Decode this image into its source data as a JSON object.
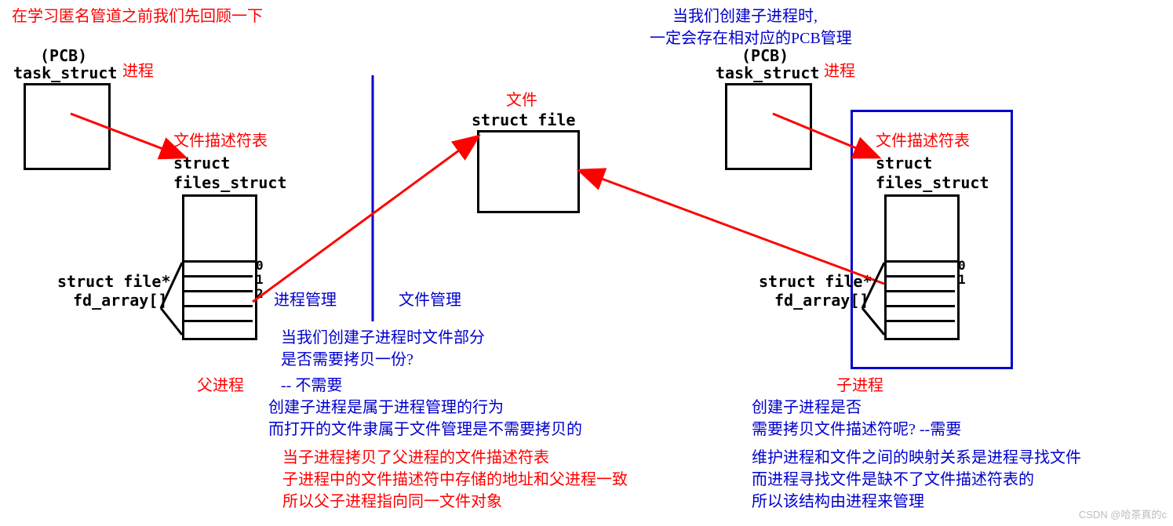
{
  "title_red": "在学习匿名管道之前我们先回顾一下",
  "top_blue_1": "当我们创建子进程时,",
  "top_blue_2": "一定会存在相对应的PCB管理",
  "left": {
    "pcb_paren": "(PCB)",
    "task_struct": "task_struct",
    "process_label": "进程",
    "fd_table_label": "文件描述符表",
    "struct_txt": "struct",
    "files_struct": "files_struct",
    "struct_file_ptr": "struct file*",
    "fd_array": "fd_array[]",
    "n0": "0",
    "n1": "1",
    "n2": "2",
    "left_mgmt": "进程管理",
    "right_mgmt": "文件管理",
    "parent_label": "父进程"
  },
  "center": {
    "file_label": "文件",
    "struct_file": "struct file",
    "q1": "当我们创建子进程时文件部分",
    "q2": "是否需要拷贝一份?",
    "q3": "-- 不需要",
    "q4": "创建子进程是属于进程管理的行为",
    "q5": "而打开的文件隶属于文件管理是不需要拷贝的",
    "r1": "当子进程拷贝了父进程的文件描述符表",
    "r2": "子进程中的文件描述符中存储的地址和父进程一致",
    "r3": "所以父子进程指向同一文件对象"
  },
  "right": {
    "pcb_paren": "(PCB)",
    "task_struct": "task_struct",
    "process_label": "进程",
    "fd_table_label": "文件描述符表",
    "struct_txt": "struct",
    "files_struct": "files_struct",
    "struct_file_ptr": "struct file*",
    "fd_array": "fd_array[]",
    "n0": "0",
    "n1": "1",
    "child_label": "子进程",
    "b1": "创建子进程是否",
    "b2": "需要拷贝文件描述符呢? --需要",
    "b3": "维护进程和文件之间的映射关系是进程寻找文件",
    "b4": "而进程寻找文件是缺不了文件描述符表的",
    "b5": "所以该结构由进程来管理"
  },
  "watermark": "CSDN @哈茶真的c"
}
